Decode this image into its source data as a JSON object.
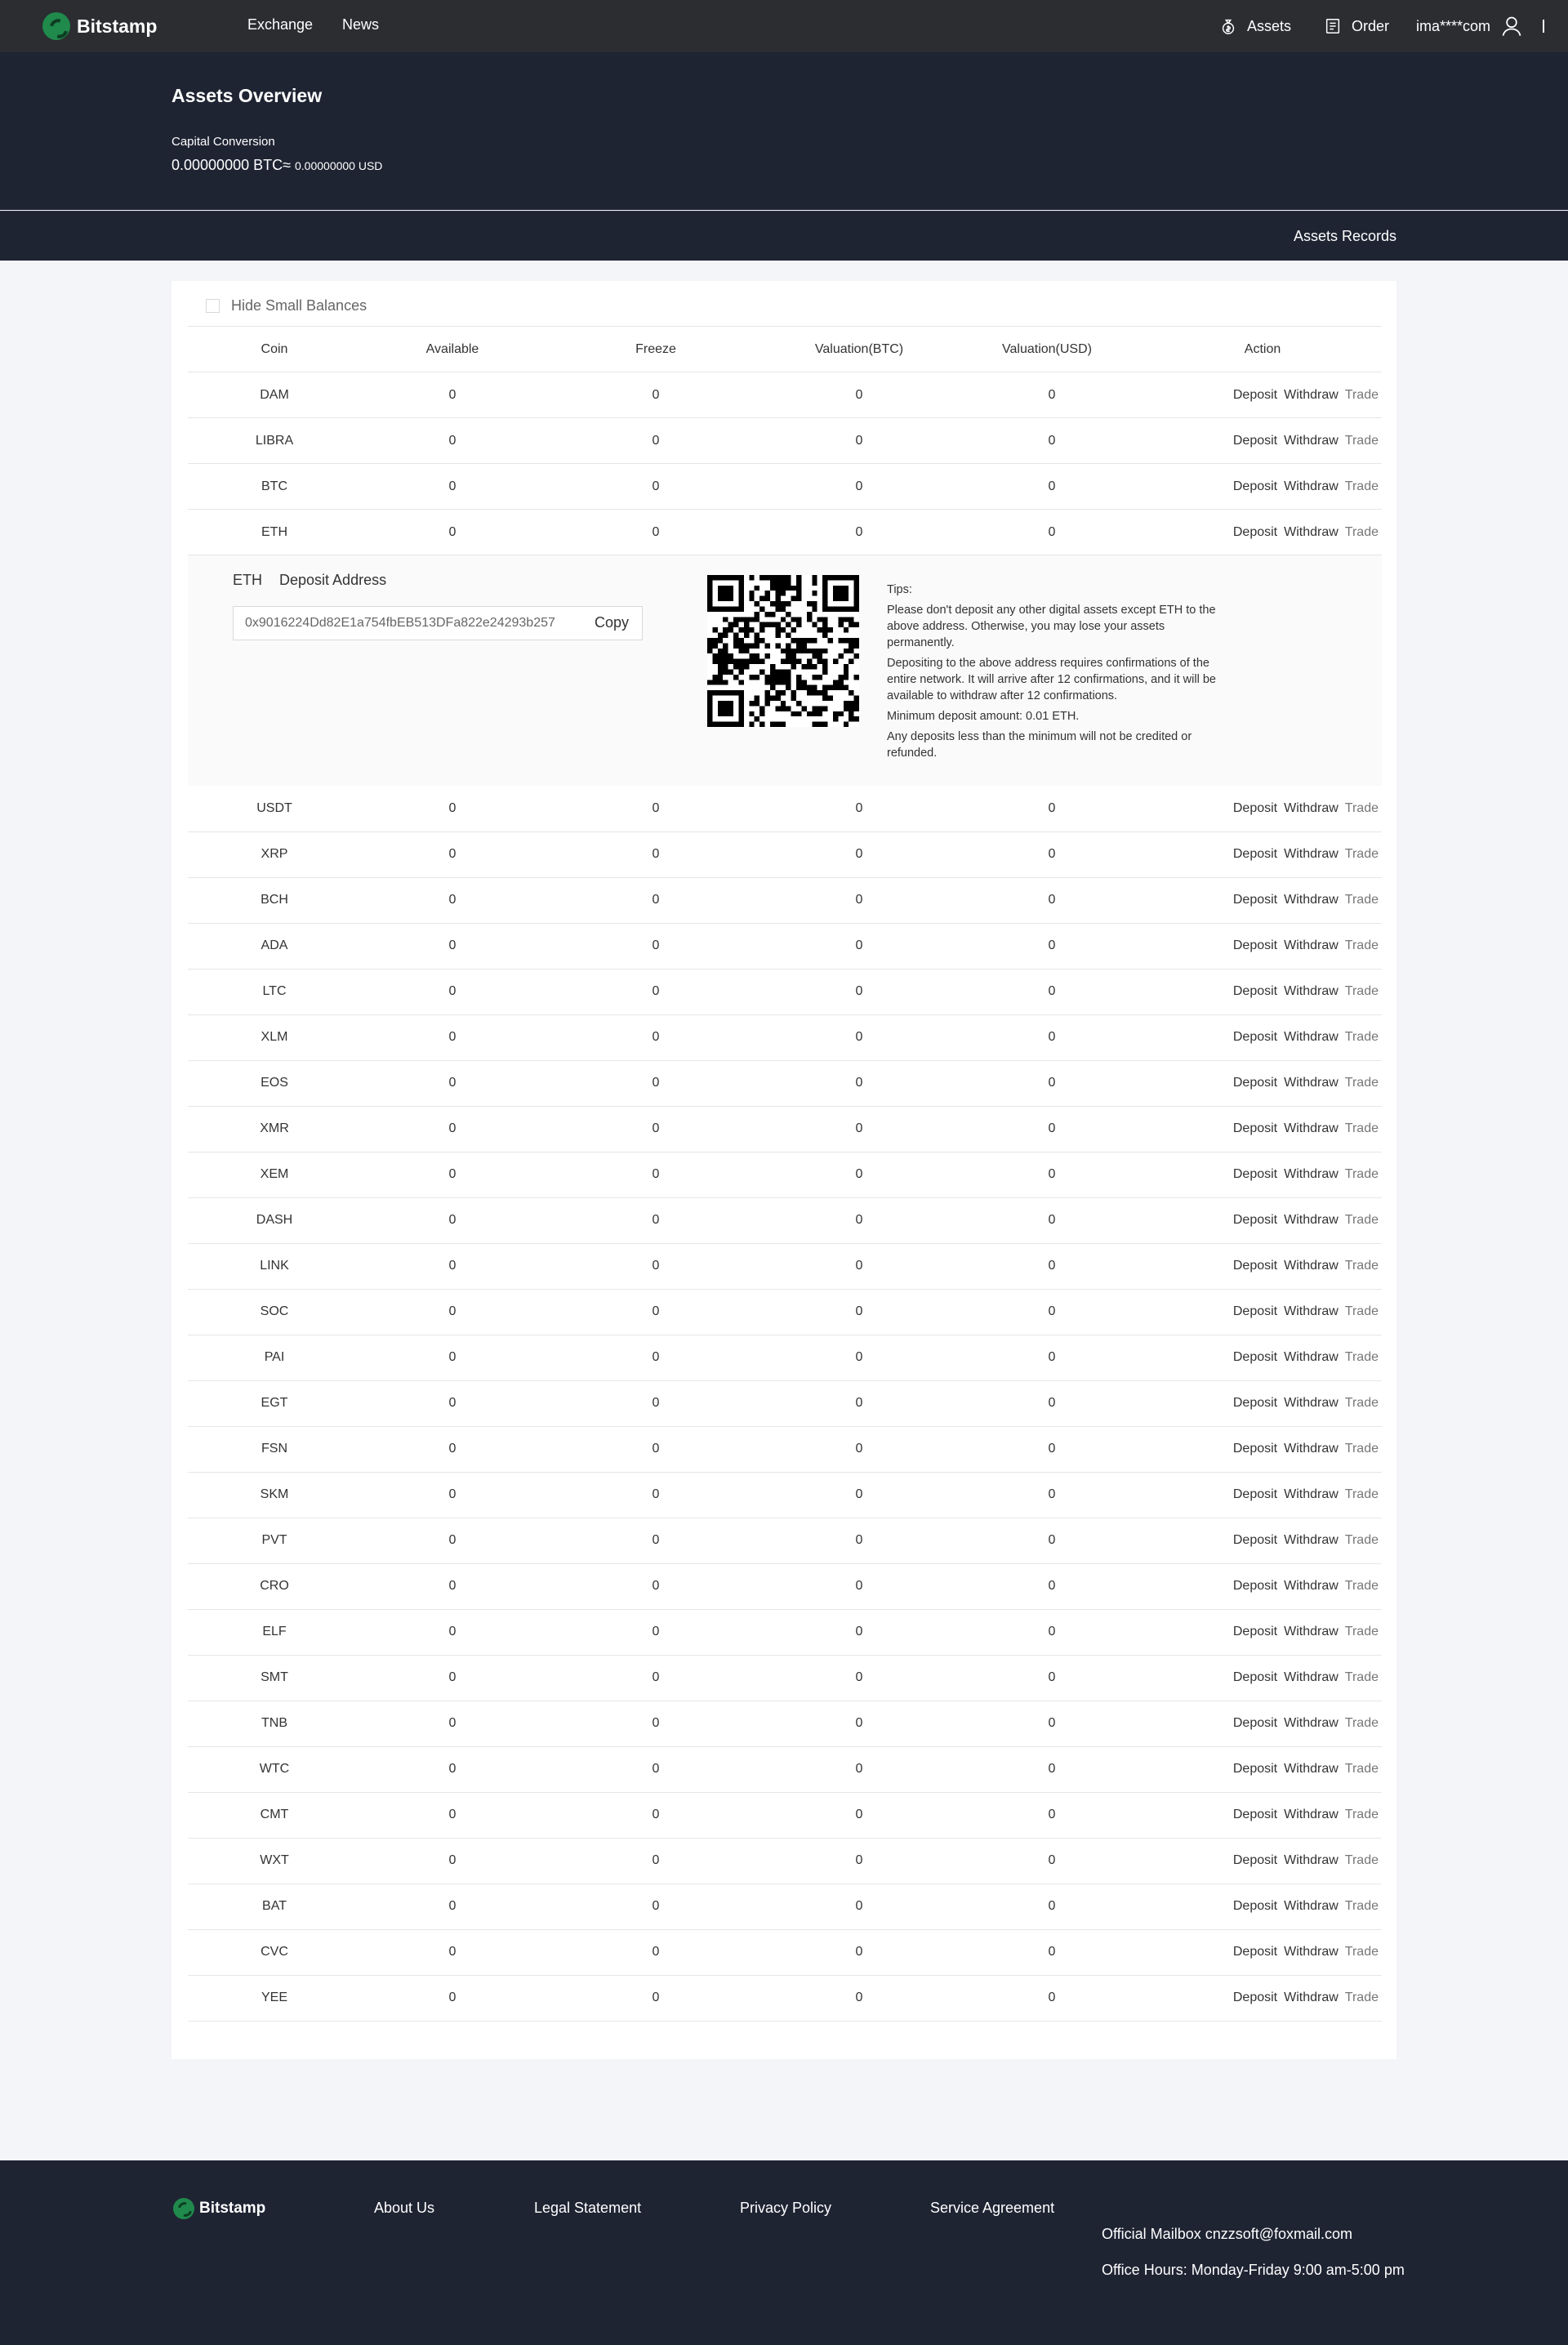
{
  "nav": {
    "brand": "Bitstamp",
    "exchange": "Exchange",
    "news": "News",
    "assets": "Assets",
    "order": "Order",
    "user": "ima****com"
  },
  "header": {
    "title": "Assets Overview",
    "capital_label": "Capital Conversion",
    "capital_btc": "0.00000000 BTC≈",
    "capital_usd": "0.00000000 USD",
    "records": "Assets Records"
  },
  "filter": {
    "hide_small": "Hide Small Balances"
  },
  "table": {
    "columns": [
      "Coin",
      "Available",
      "Freeze",
      "Valuation(BTC)",
      "Valuation(USD)",
      "Action"
    ],
    "actions": {
      "deposit": "Deposit",
      "withdraw": "Withdraw",
      "trade": "Trade"
    },
    "rows_before": [
      {
        "coin": "DAM",
        "available": "0",
        "freeze": "0",
        "btc": "0",
        "usd": "0"
      },
      {
        "coin": "LIBRA",
        "available": "0",
        "freeze": "0",
        "btc": "0",
        "usd": "0"
      },
      {
        "coin": "BTC",
        "available": "0",
        "freeze": "0",
        "btc": "0",
        "usd": "0"
      },
      {
        "coin": "ETH",
        "available": "0",
        "freeze": "0",
        "btc": "0",
        "usd": "0"
      }
    ],
    "rows_after": [
      {
        "coin": "USDT",
        "available": "0",
        "freeze": "0",
        "btc": "0",
        "usd": "0"
      },
      {
        "coin": "XRP",
        "available": "0",
        "freeze": "0",
        "btc": "0",
        "usd": "0"
      },
      {
        "coin": "BCH",
        "available": "0",
        "freeze": "0",
        "btc": "0",
        "usd": "0"
      },
      {
        "coin": "ADA",
        "available": "0",
        "freeze": "0",
        "btc": "0",
        "usd": "0"
      },
      {
        "coin": "LTC",
        "available": "0",
        "freeze": "0",
        "btc": "0",
        "usd": "0"
      },
      {
        "coin": "XLM",
        "available": "0",
        "freeze": "0",
        "btc": "0",
        "usd": "0"
      },
      {
        "coin": "EOS",
        "available": "0",
        "freeze": "0",
        "btc": "0",
        "usd": "0"
      },
      {
        "coin": "XMR",
        "available": "0",
        "freeze": "0",
        "btc": "0",
        "usd": "0"
      },
      {
        "coin": "XEM",
        "available": "0",
        "freeze": "0",
        "btc": "0",
        "usd": "0"
      },
      {
        "coin": "DASH",
        "available": "0",
        "freeze": "0",
        "btc": "0",
        "usd": "0"
      },
      {
        "coin": "LINK",
        "available": "0",
        "freeze": "0",
        "btc": "0",
        "usd": "0"
      },
      {
        "coin": "SOC",
        "available": "0",
        "freeze": "0",
        "btc": "0",
        "usd": "0"
      },
      {
        "coin": "PAI",
        "available": "0",
        "freeze": "0",
        "btc": "0",
        "usd": "0"
      },
      {
        "coin": "EGT",
        "available": "0",
        "freeze": "0",
        "btc": "0",
        "usd": "0"
      },
      {
        "coin": "FSN",
        "available": "0",
        "freeze": "0",
        "btc": "0",
        "usd": "0"
      },
      {
        "coin": "SKM",
        "available": "0",
        "freeze": "0",
        "btc": "0",
        "usd": "0"
      },
      {
        "coin": "PVT",
        "available": "0",
        "freeze": "0",
        "btc": "0",
        "usd": "0"
      },
      {
        "coin": "CRO",
        "available": "0",
        "freeze": "0",
        "btc": "0",
        "usd": "0"
      },
      {
        "coin": "ELF",
        "available": "0",
        "freeze": "0",
        "btc": "0",
        "usd": "0"
      },
      {
        "coin": "SMT",
        "available": "0",
        "freeze": "0",
        "btc": "0",
        "usd": "0"
      },
      {
        "coin": "TNB",
        "available": "0",
        "freeze": "0",
        "btc": "0",
        "usd": "0"
      },
      {
        "coin": "WTC",
        "available": "0",
        "freeze": "0",
        "btc": "0",
        "usd": "0"
      },
      {
        "coin": "CMT",
        "available": "0",
        "freeze": "0",
        "btc": "0",
        "usd": "0"
      },
      {
        "coin": "WXT",
        "available": "0",
        "freeze": "0",
        "btc": "0",
        "usd": "0"
      },
      {
        "coin": "BAT",
        "available": "0",
        "freeze": "0",
        "btc": "0",
        "usd": "0"
      },
      {
        "coin": "CVC",
        "available": "0",
        "freeze": "0",
        "btc": "0",
        "usd": "0"
      },
      {
        "coin": "YEE",
        "available": "0",
        "freeze": "0",
        "btc": "0",
        "usd": "0"
      }
    ]
  },
  "deposit": {
    "coin": "ETH",
    "title": "Deposit Address",
    "address": "0x9016224Dd82E1a754fbEB513DFa822e24293b257",
    "copy": "Copy",
    "tips_title": "Tips:",
    "tips": [
      "Please don't deposit any other digital assets except ETH to the above address. Otherwise, you may lose your assets permanently.",
      "Depositing to the above address requires confirmations of the entire network. It will arrive after 12 confirmations, and it will be available to withdraw after 12 confirmations.",
      "Minimum deposit amount: 0.01 ETH.",
      "Any deposits less than the minimum will not be credited or refunded."
    ]
  },
  "footer": {
    "brand": "Bitstamp",
    "about": "About Us",
    "legal": "Legal Statement",
    "privacy": "Privacy Policy",
    "service": "Service Agreement",
    "mailbox": "Official Mailbox cnzzsoft@foxmail.com",
    "hours": "Office Hours: Monday-Friday 9:00 am-5:00 pm"
  },
  "colors": {
    "nav_bg": "#2b2d31",
    "header_bg": "#1f2433",
    "brand_green": "#1f8a4c",
    "page_bg": "#f4f5f8"
  }
}
